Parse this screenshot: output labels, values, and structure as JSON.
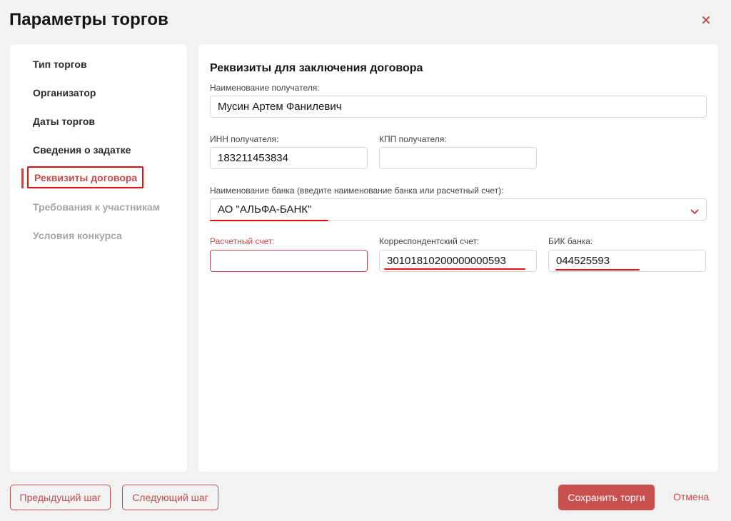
{
  "header": {
    "title": "Параметры торгов"
  },
  "sidebar": {
    "items": [
      {
        "label": "Тип торгов"
      },
      {
        "label": "Организатор"
      },
      {
        "label": "Даты торгов"
      },
      {
        "label": "Сведения о задатке"
      },
      {
        "label": "Реквизиты договора"
      },
      {
        "label": "Требования к участникам"
      },
      {
        "label": "Условия конкурса"
      }
    ]
  },
  "form": {
    "section_title": "Реквизиты для заключения договора",
    "recipient_name": {
      "label": "Наименование получателя:",
      "value": "Мусин Артем Фанилевич"
    },
    "inn": {
      "label": "ИНН получателя:",
      "value": "183211453834"
    },
    "kpp": {
      "label": "КПП получателя:",
      "value": ""
    },
    "bank_name": {
      "label": "Наименование банка (введите наименование банка или расчетный счет):",
      "value": "АО \"АЛЬФА-БАНК\""
    },
    "account": {
      "label": "Расчетный счет:",
      "value": ""
    },
    "corr_account": {
      "label": "Корреспондентский счет:",
      "value": "30101810200000000593"
    },
    "bik": {
      "label": "БИК банка:",
      "value": "044525593"
    }
  },
  "footer": {
    "prev_label": "Предыдущий шаг",
    "next_label": "Следующий шаг",
    "save_label": "Сохранить торги",
    "cancel_label": "Отмена"
  },
  "colors": {
    "accent": "#c54b4b",
    "highlight": "#e01010"
  }
}
